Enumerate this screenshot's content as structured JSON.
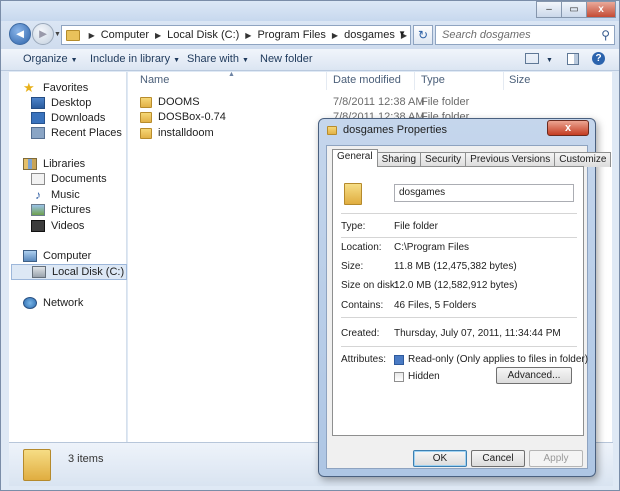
{
  "explorer": {
    "window_buttons": {
      "minimize": "–",
      "maximize": "▭",
      "close": "x"
    },
    "breadcrumb": [
      "Computer",
      "Local Disk (C:)",
      "Program Files",
      "dosgames"
    ],
    "search_placeholder": "Search dosgames",
    "toolbar": {
      "organize": "Organize",
      "include": "Include in library",
      "share": "Share with",
      "newfolder": "New folder"
    },
    "nav": {
      "favorites": "Favorites",
      "favorites_items": [
        "Desktop",
        "Downloads",
        "Recent Places"
      ],
      "libraries": "Libraries",
      "libraries_items": [
        "Documents",
        "Music",
        "Pictures",
        "Videos"
      ],
      "computer": "Computer",
      "computer_items": [
        "Local Disk (C:)"
      ],
      "network": "Network"
    },
    "columns": {
      "name": "Name",
      "date": "Date modified",
      "type": "Type",
      "size": "Size"
    },
    "files": [
      {
        "name": "DOOMS",
        "date": "7/8/2011 12:38 AM",
        "type": "File folder"
      },
      {
        "name": "DOSBox-0.74",
        "date": "7/8/2011 12:38 AM",
        "type": "File folder"
      },
      {
        "name": "installdoom",
        "date": "",
        "type": ""
      }
    ],
    "status": "3 items"
  },
  "dialog": {
    "title": "dosgames Properties",
    "close": "x",
    "tabs": [
      "General",
      "Sharing",
      "Security",
      "Previous Versions",
      "Customize"
    ],
    "name": "dosgames",
    "type_label": "Type:",
    "type_value": "File folder",
    "location_label": "Location:",
    "location_value": "C:\\Program Files",
    "size_label": "Size:",
    "size_value": "11.8 MB (12,475,382 bytes)",
    "sizeondisk_label": "Size on disk:",
    "sizeondisk_value": "12.0 MB (12,582,912 bytes)",
    "contains_label": "Contains:",
    "contains_value": "46 Files, 5 Folders",
    "created_label": "Created:",
    "created_value": "Thursday, July 07, 2011, 11:34:44 PM",
    "attributes_label": "Attributes:",
    "readonly_label": "Read-only (Only applies to files in folder)",
    "hidden_label": "Hidden",
    "advanced": "Advanced...",
    "ok": "OK",
    "cancel": "Cancel",
    "apply": "Apply"
  }
}
